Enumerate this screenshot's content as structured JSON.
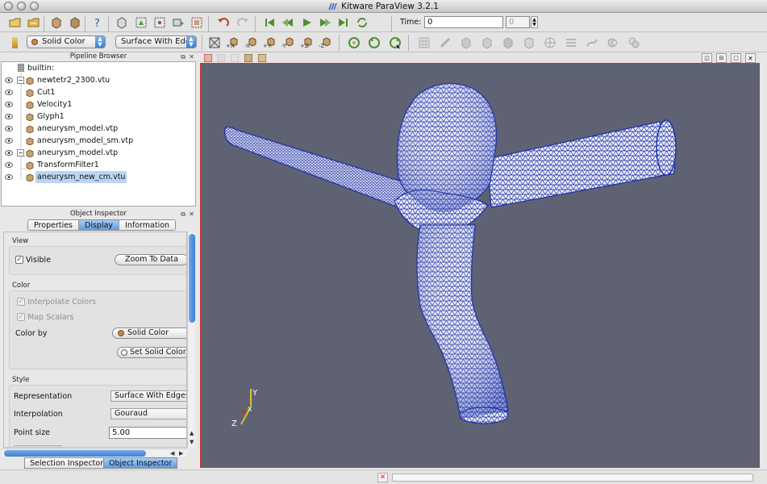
{
  "window": {
    "title": "Kitware ParaView 3.2.1"
  },
  "toolbar": {
    "color_mode": "Solid Color",
    "representation": "Surface With Edge",
    "time_label": "Time:",
    "time_value": "0",
    "timestep_value": "0"
  },
  "pipeline": {
    "title": "Pipeline Browser",
    "root": "builtin:",
    "items": [
      {
        "label": "newtetr2_2300.vtu",
        "indent": 1
      },
      {
        "label": "Cut1",
        "indent": 2
      },
      {
        "label": "Velocity1",
        "indent": 2
      },
      {
        "label": "Glyph1",
        "indent": 2
      },
      {
        "label": "aneurysm_model.vtp",
        "indent": 1
      },
      {
        "label": "aneurysm_model_sm.vtp",
        "indent": 1
      },
      {
        "label": "aneurysm_model.vtp",
        "indent": 1
      },
      {
        "label": "TransformFilter1",
        "indent": 2
      },
      {
        "label": "aneurysm_new_cm.vtu",
        "indent": 1
      }
    ]
  },
  "inspector": {
    "title": "Object Inspector",
    "tabs": [
      "Properties",
      "Display",
      "Information"
    ],
    "view_group": "View",
    "visible_label": "Visible",
    "zoom_button": "Zoom To Data",
    "color_group": "Color",
    "interpolate_label": "Interpolate Colors",
    "map_scalars_label": "Map Scalars",
    "color_by_label": "Color by",
    "color_by_value": "Solid Color",
    "set_solid_color_button": "Set Solid Color...",
    "style_group": "Style",
    "representation_label": "Representation",
    "representation_value": "Surface With Edges",
    "interpolation_label": "Interpolation",
    "interpolation_value": "Gouraud",
    "point_size_label": "Point size",
    "point_size_value": "5.00"
  },
  "bottom_tabs": [
    "Selection Inspector",
    "Object Inspector"
  ],
  "axes": {
    "x": "X",
    "y": "Y",
    "z": "Z"
  },
  "colors": {
    "mesh": "#1b2fa8",
    "mesh_fill": "#e8eaf4",
    "background": "#5e6273",
    "accent": "#4a8ae0",
    "active_border": "#d83030"
  }
}
